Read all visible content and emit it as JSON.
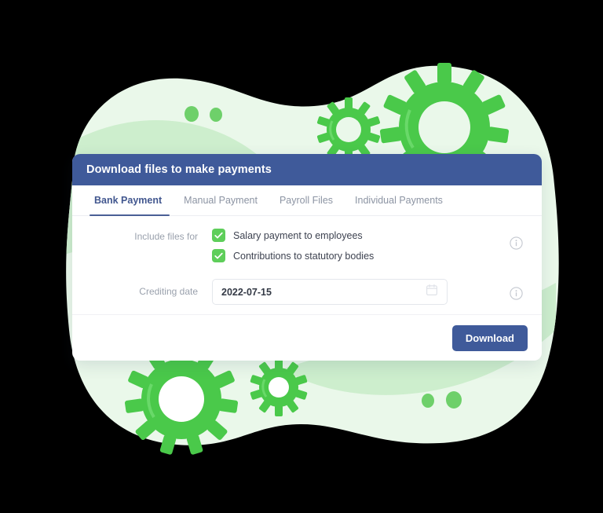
{
  "dialog": {
    "title": "Download files to make payments",
    "tabs": [
      {
        "label": "Bank Payment",
        "active": true
      },
      {
        "label": "Manual Payment",
        "active": false
      },
      {
        "label": "Payroll Files",
        "active": false
      },
      {
        "label": "Individual Payments",
        "active": false
      }
    ],
    "include_files": {
      "label": "Include files for",
      "options": [
        {
          "label": "Salary payment to employees",
          "checked": true
        },
        {
          "label": "Contributions to statutory bodies",
          "checked": true
        }
      ],
      "info_icon": "info-circle-icon"
    },
    "crediting_date": {
      "label": "Crediting date",
      "value": "2022-07-15",
      "calendar_icon": "calendar-icon",
      "info_icon": "info-circle-icon"
    },
    "footer": {
      "download_label": "Download"
    }
  },
  "theme": {
    "header_blue": "#3f5a9a",
    "accent_green": "#5ece5a",
    "tab_active": "#42578f",
    "tab_inactive": "#8c94a3",
    "blob_outer": "#eaf8ea",
    "blob_inner": "#cdeecd",
    "card_background": "#ffffff"
  },
  "decoration": {
    "gears": [
      {
        "name": "gear-top-large",
        "teeth": 11
      },
      {
        "name": "gear-top-small",
        "teeth": 10
      },
      {
        "name": "gear-bottom-large",
        "teeth": 11
      },
      {
        "name": "gear-bottom-small",
        "teeth": 10
      }
    ],
    "dots": [
      {
        "name": "dot-top-left"
      },
      {
        "name": "dot-top-right"
      },
      {
        "name": "dot-bottom-left"
      },
      {
        "name": "dot-bottom-right"
      }
    ]
  }
}
